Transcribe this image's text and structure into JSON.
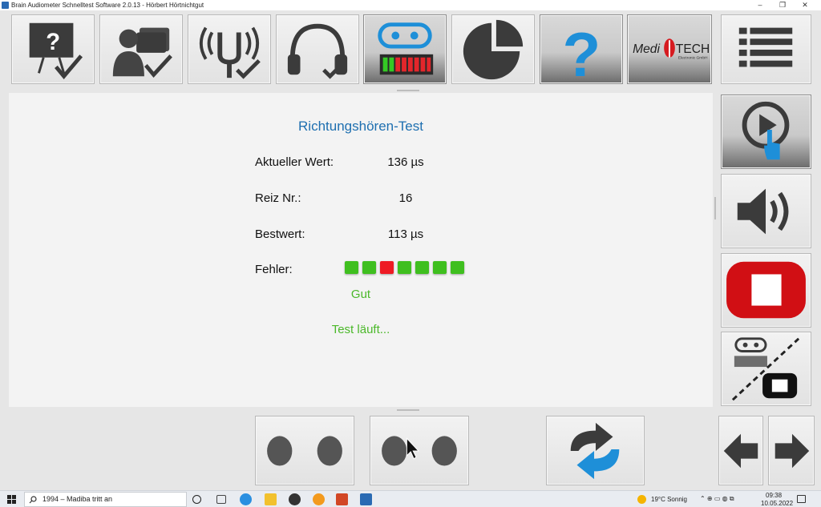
{
  "window": {
    "title": "Brain Audiometer Schnelltest Software 2.0.13 - Hörbert Hörtnichtgut",
    "minimize": "–",
    "maximize": "❐",
    "close": "✕"
  },
  "toolbar": {
    "logo_medi": "Medi",
    "logo_tech": "TECH",
    "logo_sub": "Electronic GmbH",
    "help_mark": "?"
  },
  "test": {
    "title": "Richtungshören-Test",
    "current_label": "Aktueller Wert:",
    "current_value": "136 µs",
    "stimulus_label": "Reiz Nr.:",
    "stimulus_value": "16",
    "best_label": "Bestwert:",
    "best_value": "113 µs",
    "errors_label": "Fehler:",
    "errors": [
      "ok",
      "ok",
      "bad",
      "ok",
      "ok",
      "ok",
      "ok"
    ],
    "rating": "Gut",
    "status": "Test läuft..."
  },
  "colors": {
    "accent_blue": "#1e6fb0",
    "ok_green": "#3fbf1f",
    "error_red": "#ee1b24",
    "status_green": "#4bb82a",
    "stop_red": "#d10f14"
  },
  "taskbar": {
    "search_text": "1994 – Madiba tritt an",
    "weather": "19°C  Sonnig",
    "time": "09:38",
    "date": "10.05.2022"
  }
}
